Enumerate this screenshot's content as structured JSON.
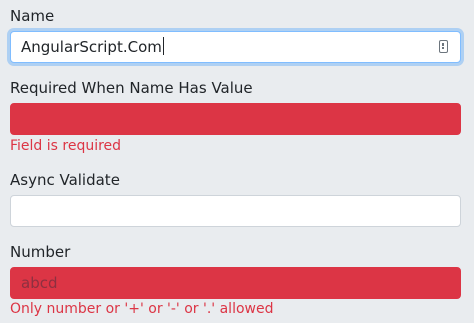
{
  "fields": {
    "name": {
      "label": "Name",
      "value": "AngularScript.Com"
    },
    "required_when_name": {
      "label": "Required When Name Has Value",
      "value": "",
      "error": "Field is required"
    },
    "async_validate": {
      "label": "Async Validate",
      "value": ""
    },
    "number": {
      "label": "Number",
      "value": "abcd",
      "error": "Only number or '+' or '-' or '.' allowed"
    }
  },
  "colors": {
    "background": "#e9ecef",
    "invalid": "#dc3545",
    "focus_border": "#80bdff"
  },
  "icons": {
    "name_field": "autofill-contact-icon"
  }
}
